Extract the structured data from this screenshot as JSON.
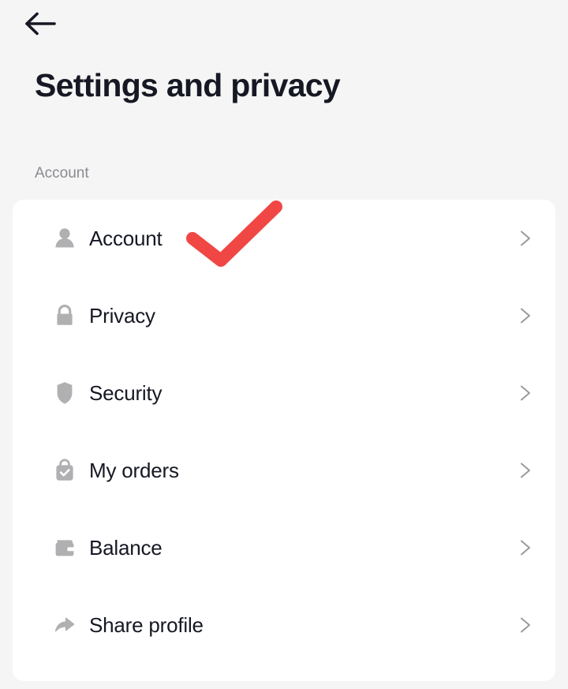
{
  "colors": {
    "page_background": "#f5f5f5",
    "card_background": "#ffffff",
    "text_primary": "#161823",
    "text_secondary": "#8a8b91",
    "icon_gray": "#b0b0b3",
    "chevron_gray": "#9a9a9e",
    "annotation_red": "#f04744"
  },
  "topbar": {
    "back_icon": "arrow-left-icon",
    "back_label": "Back"
  },
  "header": {
    "title": "Settings and privacy"
  },
  "sections": [
    {
      "label": "Account",
      "items": [
        {
          "label": "Account",
          "icon": "person-icon",
          "chevron": "chevron-right-icon"
        },
        {
          "label": "Privacy",
          "icon": "lock-icon",
          "chevron": "chevron-right-icon"
        },
        {
          "label": "Security",
          "icon": "shield-icon",
          "chevron": "chevron-right-icon"
        },
        {
          "label": "My orders",
          "icon": "shopping-bag-check-icon",
          "chevron": "chevron-right-icon"
        },
        {
          "label": "Balance",
          "icon": "wallet-icon",
          "chevron": "chevron-right-icon"
        },
        {
          "label": "Share profile",
          "icon": "share-arrow-icon",
          "chevron": "chevron-right-icon"
        }
      ]
    }
  ],
  "annotation": {
    "type": "checkmark",
    "color": "#f04744",
    "target": "Account"
  }
}
